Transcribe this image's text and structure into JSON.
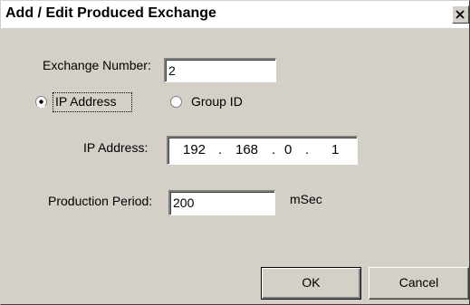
{
  "window": {
    "title": "Add / Edit Produced Exchange",
    "close_icon": "close-icon"
  },
  "exchange_number": {
    "label": "Exchange Number:",
    "value": "2"
  },
  "address_type": {
    "options": [
      {
        "label": "IP Address",
        "selected": true
      },
      {
        "label": "Group ID",
        "selected": false
      }
    ]
  },
  "ip_address": {
    "label": "IP Address:",
    "octets": [
      "192",
      "168",
      "0",
      "1"
    ],
    "separator": "."
  },
  "production_period": {
    "label": "Production Period:",
    "value": "200",
    "unit": "mSec"
  },
  "buttons": {
    "ok": "OK",
    "cancel": "Cancel"
  }
}
